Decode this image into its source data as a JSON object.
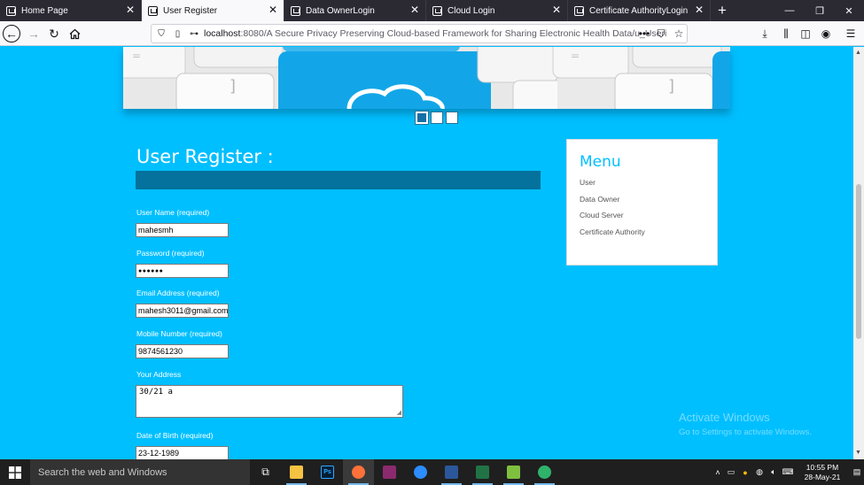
{
  "browser": {
    "tabs": [
      {
        "title": "Home Page",
        "active": false
      },
      {
        "title": "User Register",
        "active": true
      },
      {
        "title": "Data OwnerLogin",
        "active": false
      },
      {
        "title": "Cloud Login",
        "active": false
      },
      {
        "title": "Certificate AuthorityLogin",
        "active": false
      }
    ],
    "url_host": "localhost",
    "url_path": ":8080/A Secure Privacy Preserving Cloud-based Framework for Sharing Electronic Health Data/u_Useri"
  },
  "page": {
    "register_title": "User Register :",
    "fields": {
      "username": {
        "label": "User Name (required)",
        "value": "mahesmh"
      },
      "password": {
        "label": "Password (required)",
        "value": "●●●●●●"
      },
      "email": {
        "label": "Email Address (required)",
        "value": "mahesh3011@gmail.com"
      },
      "mobile": {
        "label": "Mobile Number (required)",
        "value": "9874561230"
      },
      "address": {
        "label": "Your Address",
        "value": "30/21 a"
      },
      "dob": {
        "label": "Date of Birth (required)",
        "value": "23-12-1989"
      }
    },
    "menu": {
      "title": "Menu",
      "items": [
        "User",
        "Data Owner",
        "Cloud Server",
        "Certificate Authority"
      ]
    },
    "watermark": {
      "line1": "Activate Windows",
      "line2": "Go to Settings to activate Windows."
    }
  },
  "taskbar": {
    "search_placeholder": "Search the web and Windows",
    "time": "10:55 PM",
    "date": "28-May-21"
  },
  "colors": {
    "page_background": "#00bfff",
    "title_bar": "#04729c",
    "menu_title": "#00bfff"
  }
}
